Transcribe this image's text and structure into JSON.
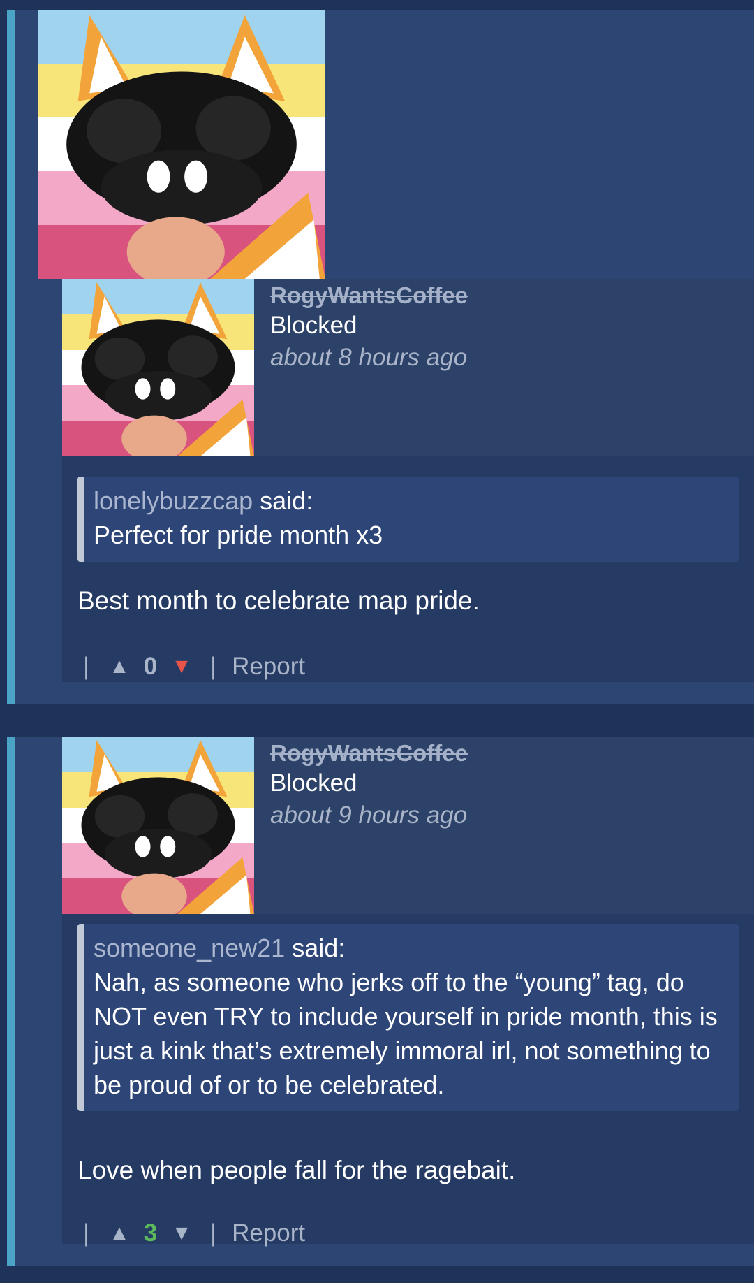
{
  "threads": [
    {
      "comment": {
        "username": "RogyWantsCoffee",
        "status": "Blocked",
        "time": "about 8 hours ago",
        "quote": {
          "author": "lonelybuzzcap",
          "said": "said:",
          "text": "Perfect for pride month x3"
        },
        "body": "Best month to celebrate map pride.",
        "actions": {
          "sep": "|",
          "up": "▲",
          "score": "0",
          "down": "▼",
          "report": "Report",
          "score_color": "#aab4c8",
          "down_color": "#e8544a",
          "up_color": "#aab4c8"
        }
      }
    },
    {
      "comment": {
        "username": "RogyWantsCoffee",
        "status": "Blocked",
        "time": "about 9 hours ago",
        "quote": {
          "author": "someone_new21",
          "said": "said:",
          "text": "Nah, as someone who jerks off to the “young” tag, do NOT even TRY to include yourself in pride month, this is just a kink that’s extremely immoral irl, not something to be proud of or to be celebrated."
        },
        "body": "Love when people fall for the ragebait.",
        "actions": {
          "sep": "|",
          "up": "▲",
          "score": "3",
          "down": "▼",
          "report": "Report",
          "score_color": "#5cb85c",
          "down_color": "#aab4c8",
          "up_color": "#aab4c8"
        }
      }
    }
  ],
  "colors": {
    "background": "#1f3257",
    "thread_bg": "#2d4573",
    "thread_accent": "#4ba3c5",
    "flag_stripes": [
      "#9fd3ee",
      "#f8e57a",
      "#ffffff",
      "#f3a8c8",
      "#d9537f"
    ]
  },
  "icons": {
    "avatar": "fox-character-avatar",
    "upvote": "triangle-up-icon",
    "downvote": "triangle-down-icon"
  }
}
